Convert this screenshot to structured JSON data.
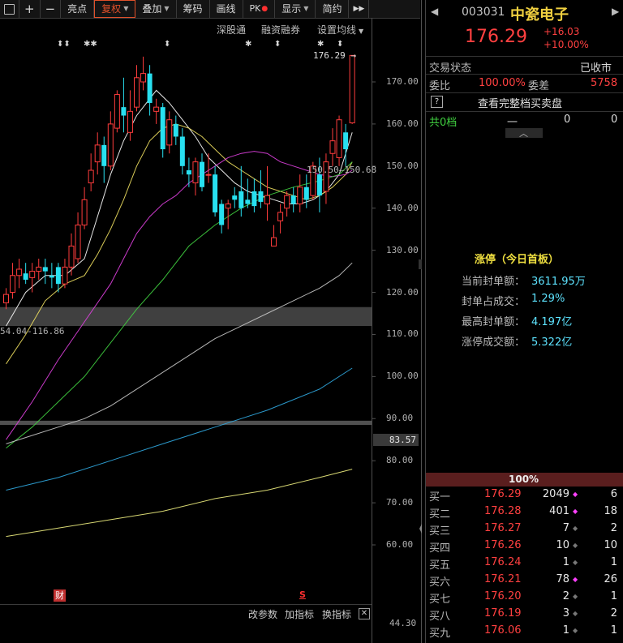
{
  "toolbar": {
    "items": [
      "亮点",
      "复权",
      "叠加",
      "筹码",
      "画线",
      "PK",
      "显示",
      "简约"
    ],
    "selected_index": 1,
    "nav_arrow": "▶▶"
  },
  "submenu": {
    "shengutong": "深股通",
    "margin": "融资融券",
    "ma_settings": "设置均线"
  },
  "price_marks": {
    "high_label": "176.29",
    "ma_label": "150.50",
    "ma_label_2": "150.68",
    "low_label": "54.04-116.86",
    "current_price_box": "83.57",
    "bottom_axis": "44.30"
  },
  "events": {
    "fin_badge": "财",
    "s_badge": "S"
  },
  "bottom_bar": {
    "change_params": "改参数",
    "add_indicator": "加指标",
    "switch_indicator": "换指标"
  },
  "stock": {
    "code": "003031",
    "name": "中瓷电子",
    "price": "176.29",
    "change": "+16.03",
    "change_pct": "+10.00%"
  },
  "status": {
    "label": "交易状态",
    "value": "已收市",
    "ratio_label": "委比",
    "ratio_value": "100.00%",
    "diff_label": "委差",
    "diff_value": "5758",
    "help": "?",
    "view_full": "查看完整档买卖盘",
    "total_levels": "共0档",
    "dash": "一",
    "zero1": "0",
    "zero2": "0"
  },
  "limit_up": {
    "title": "涨停（今日首板）",
    "rows": [
      {
        "label": "当前封单额：",
        "value": "3611.95万"
      },
      {
        "label": "封单占成交：",
        "value": "1.29%"
      },
      {
        "label": "最高封单额：",
        "value": "4.197亿"
      },
      {
        "label": "涨停成交额：",
        "value": "5.322亿"
      }
    ]
  },
  "bid_bar": "100%",
  "orderbook": [
    {
      "level": "买一",
      "price": "176.29",
      "vol": "2049",
      "mark": "mag",
      "count": "6"
    },
    {
      "level": "买二",
      "price": "176.28",
      "vol": "401",
      "mark": "mag",
      "count": "18"
    },
    {
      "level": "买三",
      "price": "176.27",
      "vol": "7",
      "mark": "gray",
      "count": "2"
    },
    {
      "level": "买四",
      "price": "176.26",
      "vol": "10",
      "mark": "gray",
      "count": "10"
    },
    {
      "level": "买五",
      "price": "176.24",
      "vol": "1",
      "mark": "gray",
      "count": "1"
    },
    {
      "level": "买六",
      "price": "176.21",
      "vol": "78",
      "mark": "mag",
      "count": "26"
    },
    {
      "level": "买七",
      "price": "176.20",
      "vol": "2",
      "mark": "gray",
      "count": "1"
    },
    {
      "level": "买八",
      "price": "176.19",
      "vol": "3",
      "mark": "gray",
      "count": "2"
    },
    {
      "level": "买九",
      "price": "176.06",
      "vol": "1",
      "mark": "gray",
      "count": "1"
    }
  ],
  "colors": {
    "up": "#ff3c3c",
    "down": "#28e0f0",
    "ma5": "#ffffff",
    "ma10": "#f0e060",
    "ma20": "#e040e0",
    "ma30": "#40d040",
    "ma60": "#c8c8c8",
    "ma120": "#30a8e0",
    "ma250": "#f0f080"
  },
  "chart_data": {
    "type": "candlestick",
    "y_ticks": [
      170,
      160,
      150,
      140,
      130,
      120,
      110,
      100,
      90,
      80,
      70,
      60
    ],
    "ylim": [
      55,
      180
    ],
    "candles": [
      {
        "o": 117.5,
        "c": 119.5,
        "h": 121,
        "l": 116
      },
      {
        "o": 120,
        "c": 124,
        "h": 127,
        "l": 118.5
      },
      {
        "o": 124,
        "c": 125.5,
        "h": 128,
        "l": 121
      },
      {
        "o": 124.5,
        "c": 123,
        "h": 127,
        "l": 122
      },
      {
        "o": 123.5,
        "c": 125,
        "h": 127,
        "l": 120
      },
      {
        "o": 125,
        "c": 126,
        "h": 128,
        "l": 123
      },
      {
        "o": 126,
        "c": 125,
        "h": 128,
        "l": 122
      },
      {
        "o": 124,
        "c": 123.5,
        "h": 127,
        "l": 121
      },
      {
        "o": 126,
        "c": 122,
        "h": 127,
        "l": 120
      },
      {
        "o": 122,
        "c": 126,
        "h": 128,
        "l": 121
      },
      {
        "o": 126,
        "c": 131,
        "h": 134,
        "l": 124
      },
      {
        "o": 128,
        "c": 136,
        "h": 139,
        "l": 127
      },
      {
        "o": 136,
        "c": 142,
        "h": 145,
        "l": 135
      },
      {
        "o": 146,
        "c": 149,
        "h": 153,
        "l": 144
      },
      {
        "o": 151,
        "c": 155,
        "h": 158,
        "l": 148
      },
      {
        "o": 155,
        "c": 150,
        "h": 157,
        "l": 146
      },
      {
        "o": 150,
        "c": 160,
        "h": 163,
        "l": 149
      },
      {
        "o": 159,
        "c": 167,
        "h": 168,
        "l": 158
      },
      {
        "o": 164,
        "c": 162,
        "h": 171,
        "l": 158
      },
      {
        "o": 158,
        "c": 163,
        "h": 168,
        "l": 156
      },
      {
        "o": 164,
        "c": 171,
        "h": 174,
        "l": 163
      },
      {
        "o": 170,
        "c": 172,
        "h": 176,
        "l": 168
      },
      {
        "o": 172,
        "c": 165,
        "h": 174,
        "l": 162
      },
      {
        "o": 163,
        "c": 164,
        "h": 166,
        "l": 160
      },
      {
        "o": 164,
        "c": 154,
        "h": 165,
        "l": 152
      },
      {
        "o": 155,
        "c": 161,
        "h": 163,
        "l": 153
      },
      {
        "o": 160,
        "c": 157,
        "h": 162,
        "l": 155
      },
      {
        "o": 157,
        "c": 150,
        "h": 159,
        "l": 148
      },
      {
        "o": 149,
        "c": 148,
        "h": 152,
        "l": 145
      },
      {
        "o": 146,
        "c": 151,
        "h": 152,
        "l": 143
      },
      {
        "o": 151,
        "c": 145,
        "h": 153,
        "l": 144
      },
      {
        "o": 148,
        "c": 148,
        "h": 153,
        "l": 146
      },
      {
        "o": 148,
        "c": 139,
        "h": 150,
        "l": 138
      },
      {
        "o": 141,
        "c": 136,
        "h": 142,
        "l": 134
      },
      {
        "o": 140,
        "c": 141,
        "h": 142,
        "l": 135
      },
      {
        "o": 143,
        "c": 142,
        "h": 145,
        "l": 140
      },
      {
        "o": 144,
        "c": 140,
        "h": 150,
        "l": 138
      },
      {
        "o": 142,
        "c": 141,
        "h": 147,
        "l": 140
      },
      {
        "o": 144,
        "c": 140.5,
        "h": 147,
        "l": 139
      },
      {
        "o": 144,
        "c": 141.5,
        "h": 149,
        "l": 140
      },
      {
        "o": 141,
        "c": 143,
        "h": 150,
        "l": 137
      },
      {
        "o": 131,
        "c": 133,
        "h": 136,
        "l": 131
      },
      {
        "o": 137,
        "c": 139,
        "h": 141,
        "l": 134
      },
      {
        "o": 140,
        "c": 143,
        "h": 144,
        "l": 138
      },
      {
        "o": 143,
        "c": 141,
        "h": 145,
        "l": 139
      },
      {
        "o": 141,
        "c": 145,
        "h": 148,
        "l": 139
      },
      {
        "o": 145,
        "c": 142,
        "h": 148,
        "l": 140
      },
      {
        "o": 143,
        "c": 150,
        "h": 151,
        "l": 142
      },
      {
        "o": 148,
        "c": 143,
        "h": 152,
        "l": 139
      },
      {
        "o": 144,
        "c": 151,
        "h": 153,
        "l": 141
      },
      {
        "o": 153,
        "c": 156,
        "h": 159,
        "l": 150
      },
      {
        "o": 152,
        "c": 161,
        "h": 162,
        "l": 150
      },
      {
        "o": 158,
        "c": 154,
        "h": 160,
        "l": 150
      },
      {
        "o": 160.26,
        "c": 176.29,
        "h": 176.29,
        "l": 160
      }
    ],
    "ma_lines": [
      {
        "key": "ma5",
        "pts": [
          [
            0,
            112
          ],
          [
            3,
            120
          ],
          [
            6,
            124
          ],
          [
            9,
            124
          ],
          [
            12,
            128
          ],
          [
            14,
            138
          ],
          [
            16,
            148
          ],
          [
            18,
            156
          ],
          [
            20,
            162
          ],
          [
            22,
            166
          ],
          [
            23,
            168
          ],
          [
            25,
            165
          ],
          [
            27,
            161
          ],
          [
            29,
            157
          ],
          [
            31,
            152
          ],
          [
            33,
            149
          ],
          [
            35,
            146
          ],
          [
            37,
            144
          ],
          [
            39,
            143
          ],
          [
            41,
            142
          ],
          [
            43,
            141
          ],
          [
            45,
            141
          ],
          [
            47,
            142
          ],
          [
            49,
            144
          ],
          [
            51,
            148
          ],
          [
            53,
            158
          ]
        ]
      },
      {
        "key": "ma10",
        "pts": [
          [
            0,
            103
          ],
          [
            3,
            110
          ],
          [
            6,
            118
          ],
          [
            9,
            122
          ],
          [
            12,
            124
          ],
          [
            14,
            129
          ],
          [
            16,
            135
          ],
          [
            18,
            142
          ],
          [
            20,
            150
          ],
          [
            22,
            156
          ],
          [
            24,
            159
          ],
          [
            26,
            160
          ],
          [
            28,
            159
          ],
          [
            30,
            157
          ],
          [
            32,
            154
          ],
          [
            34,
            151
          ],
          [
            36,
            149
          ],
          [
            38,
            147
          ],
          [
            40,
            145
          ],
          [
            42,
            144
          ],
          [
            44,
            143
          ],
          [
            46,
            142
          ],
          [
            48,
            143
          ],
          [
            50,
            145
          ],
          [
            52,
            148
          ],
          [
            53,
            151
          ]
        ]
      },
      {
        "key": "ma20",
        "pts": [
          [
            0,
            85
          ],
          [
            4,
            94
          ],
          [
            8,
            104
          ],
          [
            12,
            113
          ],
          [
            16,
            122
          ],
          [
            18,
            128
          ],
          [
            20,
            134
          ],
          [
            22,
            138
          ],
          [
            24,
            141
          ],
          [
            26,
            143
          ],
          [
            28,
            146
          ],
          [
            30,
            148
          ],
          [
            32,
            150
          ],
          [
            34,
            152
          ],
          [
            36,
            153
          ],
          [
            38,
            153.5
          ],
          [
            40,
            153
          ],
          [
            42,
            151
          ],
          [
            44,
            150
          ],
          [
            46,
            149
          ],
          [
            48,
            148
          ],
          [
            50,
            147.5
          ],
          [
            52,
            148
          ],
          [
            53,
            149
          ]
        ]
      },
      {
        "key": "ma30",
        "pts": [
          [
            0,
            83
          ],
          [
            4,
            88
          ],
          [
            8,
            94
          ],
          [
            12,
            100
          ],
          [
            16,
            108
          ],
          [
            20,
            116
          ],
          [
            24,
            123
          ],
          [
            28,
            131
          ],
          [
            32,
            136
          ],
          [
            36,
            140
          ],
          [
            40,
            143
          ],
          [
            44,
            145
          ],
          [
            48,
            146.5
          ],
          [
            51,
            148
          ],
          [
            53,
            151
          ]
        ]
      },
      {
        "key": "ma60",
        "pts": [
          [
            0,
            84
          ],
          [
            4,
            86
          ],
          [
            8,
            88
          ],
          [
            12,
            90
          ],
          [
            16,
            93
          ],
          [
            20,
            97
          ],
          [
            24,
            101
          ],
          [
            28,
            105
          ],
          [
            32,
            109
          ],
          [
            36,
            112
          ],
          [
            40,
            115
          ],
          [
            44,
            118
          ],
          [
            48,
            121
          ],
          [
            51,
            124
          ],
          [
            53,
            127
          ]
        ]
      },
      {
        "key": "ma120",
        "pts": [
          [
            0,
            73
          ],
          [
            8,
            76
          ],
          [
            16,
            80
          ],
          [
            24,
            84
          ],
          [
            32,
            88
          ],
          [
            40,
            92
          ],
          [
            48,
            97
          ],
          [
            53,
            102
          ]
        ]
      },
      {
        "key": "ma250",
        "pts": [
          [
            0,
            62
          ],
          [
            8,
            64
          ],
          [
            16,
            66
          ],
          [
            24,
            68
          ],
          [
            32,
            71
          ],
          [
            40,
            73
          ],
          [
            48,
            76
          ],
          [
            53,
            78
          ]
        ]
      }
    ],
    "bands": [
      {
        "from": 116.5,
        "to": 112,
        "color": "#404040"
      },
      {
        "from": 89.5,
        "to": 88.5,
        "color": "#505050"
      }
    ]
  }
}
